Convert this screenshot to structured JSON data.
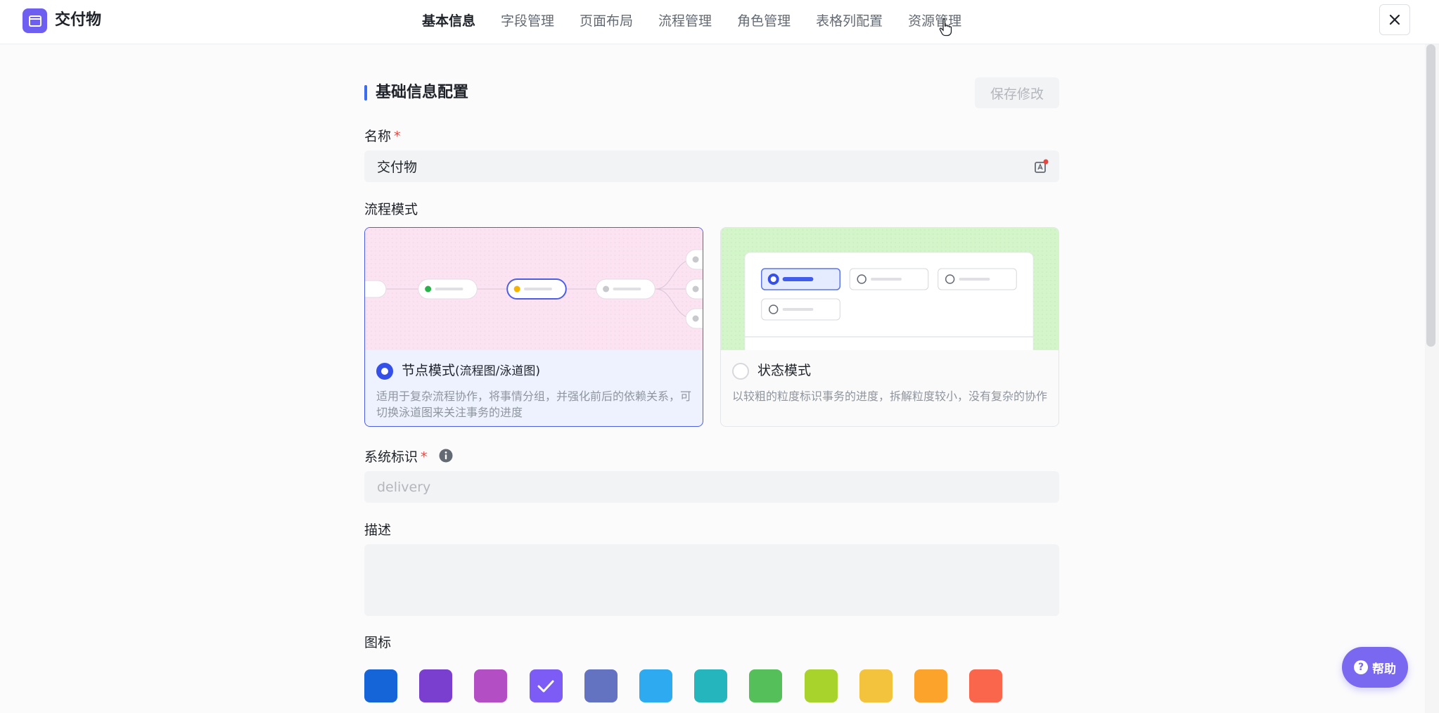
{
  "app": {
    "title": "交付物",
    "logo_icon": "folder-icon",
    "accent": "#6e5ff0"
  },
  "nav": {
    "items": [
      "基本信息",
      "字段管理",
      "页面布局",
      "流程管理",
      "角色管理",
      "表格列配置",
      "资源管理"
    ],
    "active": "基本信息"
  },
  "section": {
    "title": "基础信息配置",
    "save_label": "保存修改"
  },
  "fields": {
    "name_label": "名称",
    "required_mark": "*",
    "name_value": "交付物",
    "flow_mode_label": "流程模式",
    "system_id_label": "系统标识",
    "system_id_placeholder": "delivery",
    "description_label": "描述",
    "icon_label": "图标"
  },
  "modes": [
    {
      "name": "节点模式",
      "suffix": "(流程图/泳道图)",
      "desc": "适用于复杂流程协作，将事情分组，并强化前后的依赖关系，可切换泳道图来关注事务的进度",
      "selected": true
    },
    {
      "name": "状态模式",
      "suffix": "",
      "desc": "以较粗的粒度标识事务的进度，拆解粒度较小，没有复杂的协作",
      "selected": false
    }
  ],
  "swatches": [
    "#1565d8",
    "#7b3fd0",
    "#b34ec4",
    "#7c5cf5",
    "#6472c2",
    "#2eaaf0",
    "#25b5bd",
    "#55bf5a",
    "#a8d32c",
    "#f3c33d",
    "#fba32b",
    "#fa664c"
  ],
  "selected_swatch": 3,
  "help": {
    "label": "帮助"
  }
}
